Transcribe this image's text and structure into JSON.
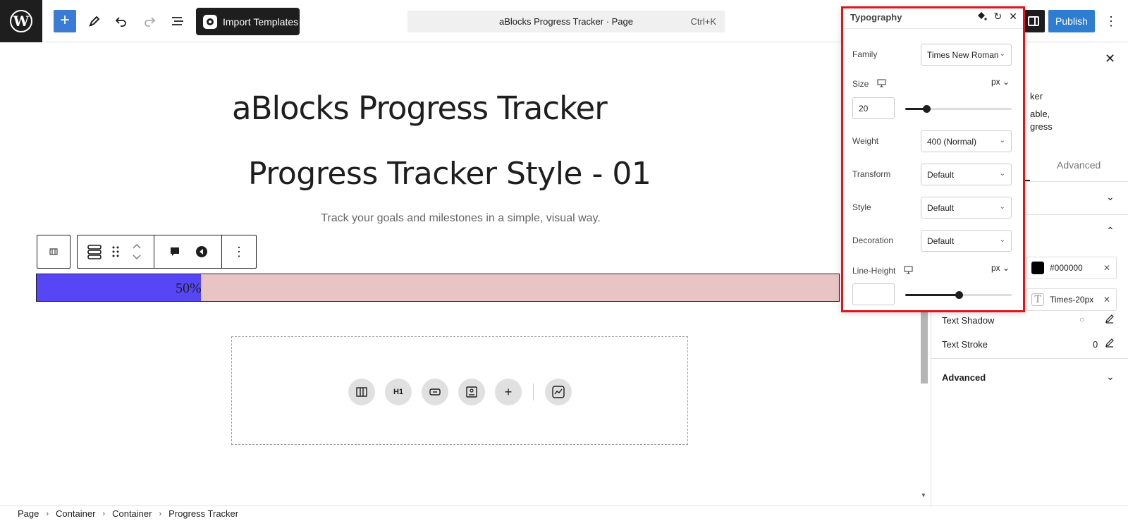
{
  "topbar": {
    "import_label": "Import Templates",
    "doc_title": "aBlocks Progress Tracker · Page",
    "shortcut": "Ctrl+K",
    "publish_label": "Publish"
  },
  "canvas": {
    "page_title": "aBlocks Progress Tracker",
    "heading": "Progress Tracker Style - 01",
    "subtitle": "Track your goals and milestones in a simple, visual way.",
    "progress": {
      "percent": 50,
      "label": "50%",
      "fill_color": "#5746f5",
      "track_color": "#e8c4c4"
    },
    "empty_container_icons": [
      "columns-icon",
      "heading-icon",
      "button-icon",
      "image-icon",
      "plus-icon",
      "chart-icon"
    ],
    "heading_icon_text": "H1"
  },
  "sidebar": {
    "partial_title": "ker",
    "partial_desc1": "able,",
    "partial_desc2": "gress",
    "advanced_tab": "Advanced",
    "color_value": "#000000",
    "font_value": "Times-20px",
    "text_shadow_label": "Text Shadow",
    "text_stroke_label": "Text Stroke",
    "text_stroke_value": "0",
    "advanced_section": "Advanced"
  },
  "typography": {
    "title": "Typography",
    "family_label": "Family",
    "family_value": "Times New Roman",
    "size_label": "Size",
    "size_unit": "px",
    "size_value": "20",
    "size_slider_fraction": 0.2,
    "weight_label": "Weight",
    "weight_value": "400 (Normal)",
    "transform_label": "Transform",
    "transform_value": "Default",
    "style_label": "Style",
    "style_value": "Default",
    "decoration_label": "Decoration",
    "decoration_value": "Default",
    "line_height_label": "Line-Height",
    "line_height_unit": "px",
    "line_height_value": "",
    "line_height_slider_fraction": 0.5
  },
  "breadcrumb": [
    "Page",
    "Container",
    "Container",
    "Progress Tracker"
  ]
}
